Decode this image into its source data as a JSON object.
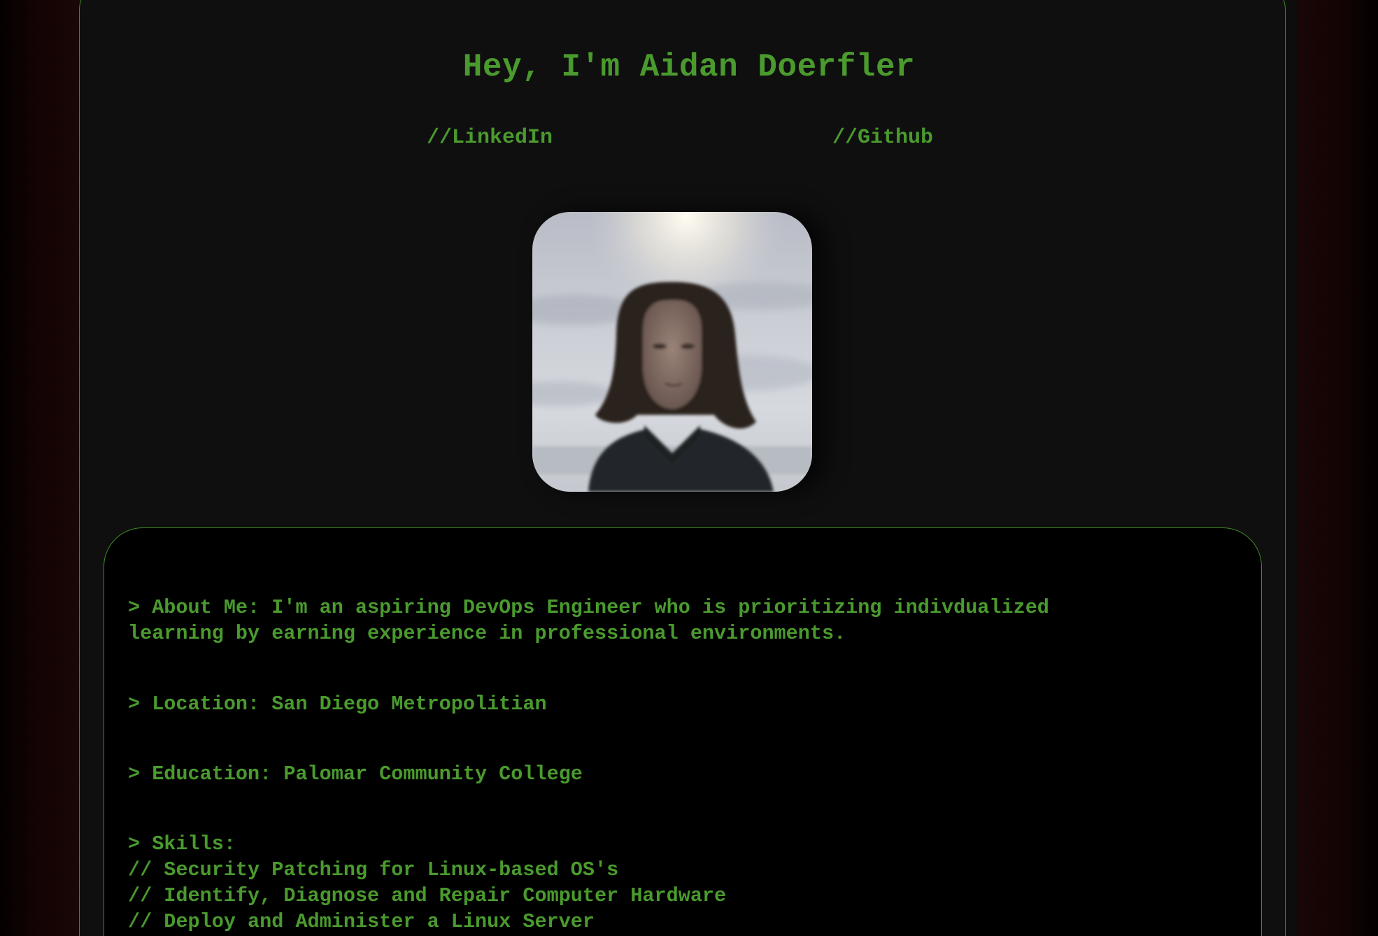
{
  "header": {
    "title": "Hey, I'm Aidan Doerfler"
  },
  "nav": {
    "linkedin_label": "//LinkedIn",
    "github_label": "//Github"
  },
  "profile": {
    "photo": "portrait-photo"
  },
  "info": {
    "about_line1": "> About Me: I'm an aspiring DevOps Engineer who is prioritizing indivdualized",
    "about_line2": "learning by earning experience in professional environments.",
    "location": "> Location: San Diego Metropolitian",
    "education": "> Education: Palomar Community College",
    "skills_heading": "> Skills:",
    "skills": [
      "// Security Patching for Linux-based OS's",
      "// Identify, Diagnose and Repair Computer Hardware",
      "// Deploy and Administer a Linux Server"
    ]
  },
  "colors": {
    "accent_green": "#4a9a2e",
    "panel_bg": "#0f0f0f",
    "info_bg": "#000000",
    "side_glow": "#1a0606"
  }
}
